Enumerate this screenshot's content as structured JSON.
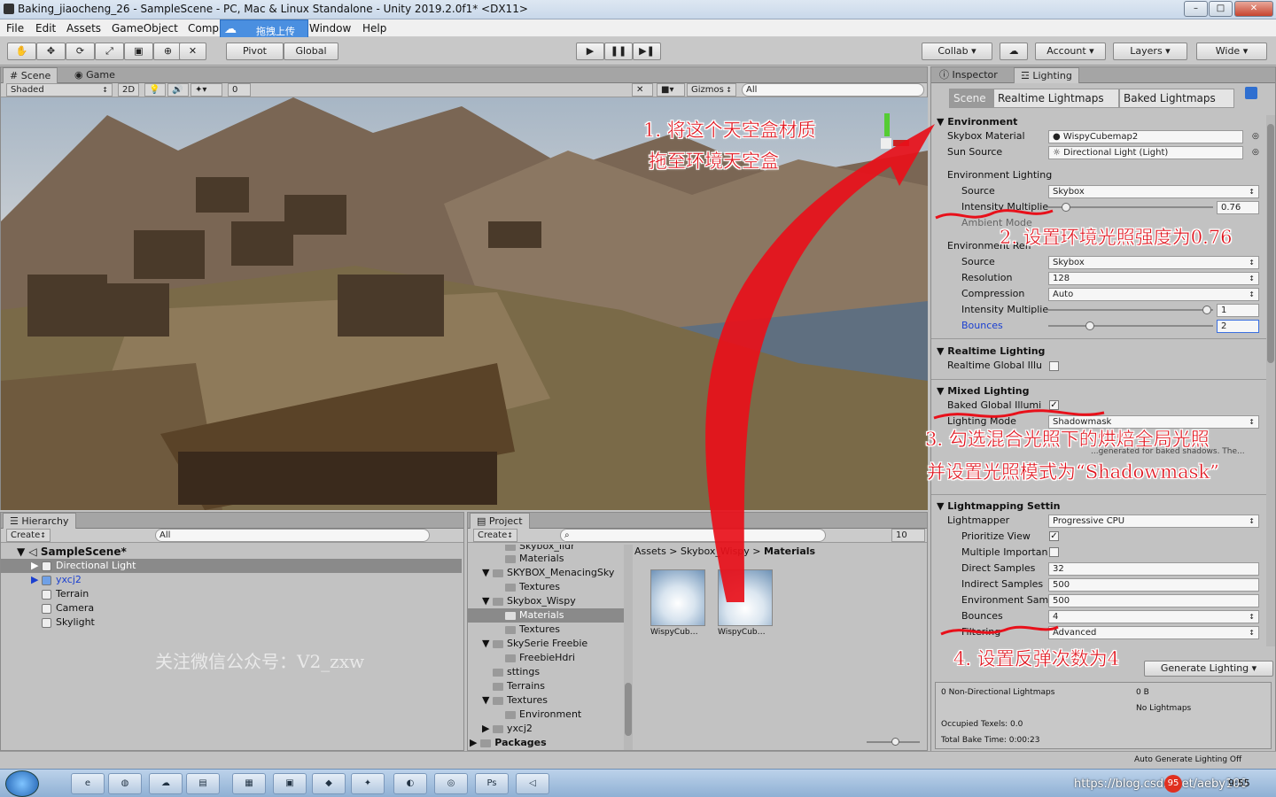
{
  "window": {
    "title": "Baking_jiaocheng_26 - SampleScene - PC, Mac & Linux Standalone - Unity 2019.2.0f1* <DX11>",
    "min": "–",
    "max": "□",
    "close": "✕"
  },
  "menu": [
    "File",
    "Edit",
    "Assets",
    "GameObject",
    "Comp",
    "Window",
    "Help"
  ],
  "upload_label": "拖拽上传",
  "toolbar": {
    "pivot": "Pivot",
    "global": "Global",
    "collab": "Collab ▾",
    "account": "Account",
    "layers": "Layers",
    "layout": "Wide"
  },
  "scene": {
    "tab_scene": "Scene",
    "tab_game": "Game",
    "shading": "Shaded",
    "mode_2d": "2D",
    "hidden_count": "0",
    "gizmos": "Gizmos",
    "search": "All"
  },
  "inspector": {
    "tab_inspector": "Inspector",
    "tab_lighting": "Lighting",
    "subtabs": [
      "Scene",
      "Realtime Lightmaps",
      "Baked Lightmaps"
    ]
  },
  "env": {
    "header": "Environment",
    "skybox_label": "Skybox Material",
    "skybox_value": "WispyCubemap2",
    "sun_label": "Sun Source",
    "sun_value": "Directional Light (Light)",
    "env_lighting": "Environment Lighting",
    "source_label": "Source",
    "source_value": "Skybox",
    "intensity_label": "Intensity Multiplie",
    "intensity_value": "0.76",
    "ambient_label": "Ambient Mode",
    "reflections": "Environment Refl",
    "refl_source_label": "Source",
    "refl_source_value": "Skybox",
    "resolution_label": "Resolution",
    "resolution_value": "128",
    "compression_label": "Compression",
    "compression_value": "Auto",
    "refl_intensity_label": "Intensity Multiplie",
    "refl_intensity_value": "1",
    "bounces_label": "Bounces",
    "bounces_value": "2"
  },
  "realtime": {
    "header": "Realtime Lighting",
    "gi_label": "Realtime Global Illu"
  },
  "mixed": {
    "header": "Mixed Lighting",
    "baked_gi_label": "Baked Global Illumi",
    "mode_label": "Lighting Mode",
    "mode_value": "Shadowmask",
    "note": "...generated for baked shadows. The..."
  },
  "lightmapping": {
    "header": "Lightmapping Settin",
    "lightmapper_label": "Lightmapper",
    "lightmapper_value": "Progressive CPU",
    "prioritize_label": "Prioritize View",
    "mis_label": "Multiple Importan",
    "direct_label": "Direct Samples",
    "direct_value": "32",
    "indirect_label": "Indirect Samples",
    "indirect_value": "500",
    "env_samples_label": "Environment Sam",
    "env_samples_value": "500",
    "bounces_label": "Bounces",
    "bounces_value": "4",
    "filtering_label": "Filtering",
    "filtering_value": "Advanced"
  },
  "generate_label": "Generate Lighting",
  "bake_info": {
    "lightmaps": "0 Non-Directional Lightmaps",
    "size": "0 B",
    "no_lightmaps": "No Lightmaps",
    "texels": "Occupied Texels: 0.0",
    "time": "Total Bake Time: 0:00:23"
  },
  "status": "Auto Generate Lighting Off",
  "hierarchy": {
    "tab": "Hierarchy",
    "create": "Create",
    "search": "All",
    "scene": "SampleScene*",
    "items": [
      "Directional Light",
      "yxcj2",
      "Terrain",
      "Camera",
      "Skylight"
    ],
    "watermark": "关注微信公众号：V2_zxw"
  },
  "project": {
    "tab": "Project",
    "create": "Create",
    "count": "10",
    "tree": [
      "Skybox_Ildr",
      "Materials",
      "SKYBOX_MenacingSky",
      "Textures",
      "Skybox_Wispy",
      "Materials",
      "Textures",
      "SkySerie Freebie",
      "FreebieHdri",
      "sttings",
      "Terrains",
      "Textures",
      "Environment",
      "yxcj2",
      "Packages"
    ],
    "breadcrumb": [
      "Assets",
      "Skybox_Wispy",
      "Materials"
    ],
    "assets": [
      "WispyCub…",
      "WispyCub…"
    ]
  },
  "annotations": {
    "a1_line1": "1. 将这个天空盒材质",
    "a1_line2": "拖至环境天空盒",
    "a2": "2. 设置环境光照强度为0.76",
    "a3_line1": "3. 勾选混合光照下的烘焙全局光照",
    "a3_line2": "并设置光照模式为“Shadowmask”",
    "a4": "4. 设置反弹次数为4"
  },
  "taskbar": {
    "watermark": "https://blog.csdn.net/aeby100",
    "badge": "95",
    "clock": "9:55"
  },
  "colors": {
    "accent_red": "#e0101a",
    "selection": "#8a8a8a",
    "link_blue": "#1a3fd0"
  }
}
